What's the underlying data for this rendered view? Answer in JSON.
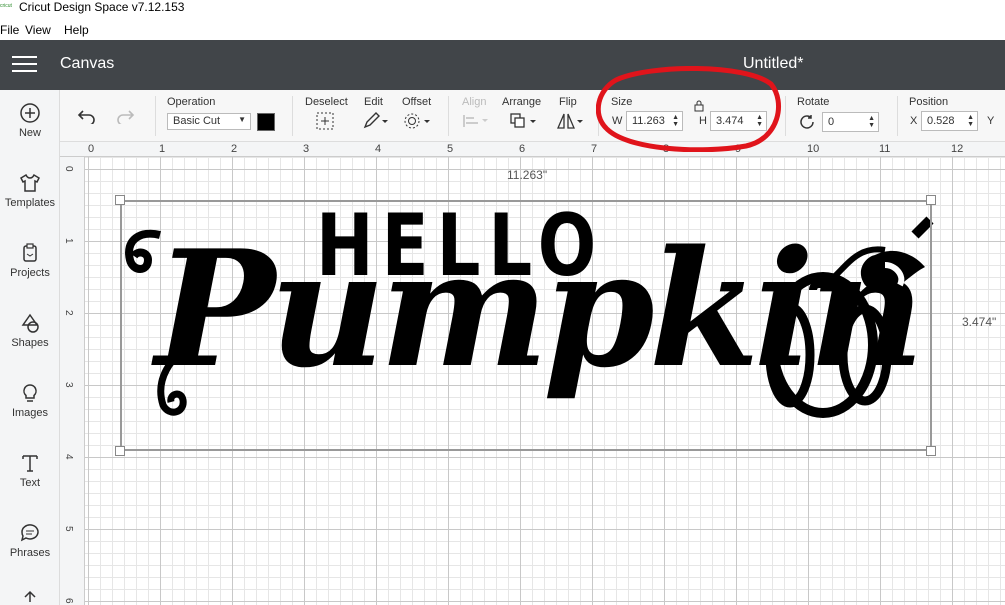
{
  "titlebar": {
    "app_title": "Cricut Design Space  v7.12.153",
    "icon_text": "cricut"
  },
  "menubar": [
    "File",
    "View",
    "Help"
  ],
  "header": {
    "section": "Canvas",
    "doc_title": "Untitled*"
  },
  "sidebar": [
    {
      "label": "New",
      "icon": "plus-circle-icon"
    },
    {
      "label": "Templates",
      "icon": "shirt-icon"
    },
    {
      "label": "Projects",
      "icon": "clipboard-icon"
    },
    {
      "label": "Shapes",
      "icon": "shapes-icon"
    },
    {
      "label": "Images",
      "icon": "lightbulb-icon"
    },
    {
      "label": "Text",
      "icon": "text-icon"
    },
    {
      "label": "Phrases",
      "icon": "speech-bubble-icon"
    }
  ],
  "toolbar": {
    "operation_label": "Operation",
    "operation_value": "Basic Cut",
    "operation_color": "#000000",
    "deselect_label": "Deselect",
    "edit_label": "Edit",
    "offset_label": "Offset",
    "align_label": "Align",
    "arrange_label": "Arrange",
    "flip_label": "Flip",
    "size_label": "Size",
    "w_label": "W",
    "w_value": "11.263",
    "h_label": "H",
    "h_value": "3.474",
    "rotate_label": "Rotate",
    "rotate_value": "0",
    "position_label": "Position",
    "x_label": "X",
    "x_value": "0.528",
    "y_label": "Y"
  },
  "ruler": {
    "top": [
      "0",
      "1",
      "2",
      "3",
      "4",
      "5",
      "6",
      "7",
      "8",
      "9",
      "10",
      "11",
      "12"
    ],
    "left": [
      "0",
      "1",
      "2",
      "3",
      "4",
      "5",
      "6"
    ]
  },
  "canvas": {
    "width_readout": "11.263\"",
    "height_readout": "3.474\"",
    "design_line1": "HELLO",
    "design_line2": "Pumpkin"
  },
  "colors": {
    "header_bg": "#414549",
    "annotation": "#e0141b"
  }
}
